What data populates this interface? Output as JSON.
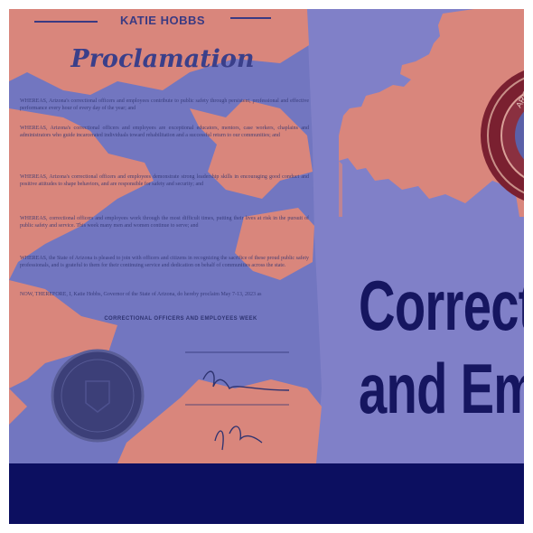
{
  "proclamation": {
    "header_name": "KATIE HOBBS",
    "title": "Proclamation",
    "paragraphs": [
      "WHEREAS, Arizona's correctional officers and employees contribute to public safety through persistent, professional and effective performance every hour of every day of the year; and",
      "WHEREAS, Arizona's correctional officers and employees are exceptional educators, mentors, case workers, chaplains and administrators who guide incarcerated individuals toward rehabilitation and a successful return to our communities; and",
      "WHEREAS, Arizona's correctional officers and employees demonstrate strong leadership skills in encouraging good conduct and positive attitudes to shape behaviors, and are responsible for safety and security; and",
      "WHEREAS, correctional officers and employees work through the most difficult times, putting their lives at risk in the pursuit of public safety and service. This week many men and women continue to serve; and",
      "WHEREAS, the State of Arizona is pleased to join with officers and citizens in recognizing the sacrifice of these proud public safety professionals, and is grateful to them for their continuing service and dedication on behalf of communities across the state.",
      "NOW, THEREFORE, I, Katie Hobbs, Governor of the State of Arizona, do hereby proclaim May 7-13, 2023 as"
    ],
    "week": "CORRECTIONAL OFFICERS AND EMPLOYEES WEEK"
  },
  "headline": {
    "line1": "Correcti",
    "line2": "and Emp"
  },
  "seal": {
    "ring_text": "ARIZONA DEPARTMENT OF CORRECTIONS REHABILITATION"
  },
  "colors": {
    "field": "#8080c8",
    "accent_salmon": "#d9867c",
    "headline": "#161660",
    "band": "#0c0f60"
  }
}
